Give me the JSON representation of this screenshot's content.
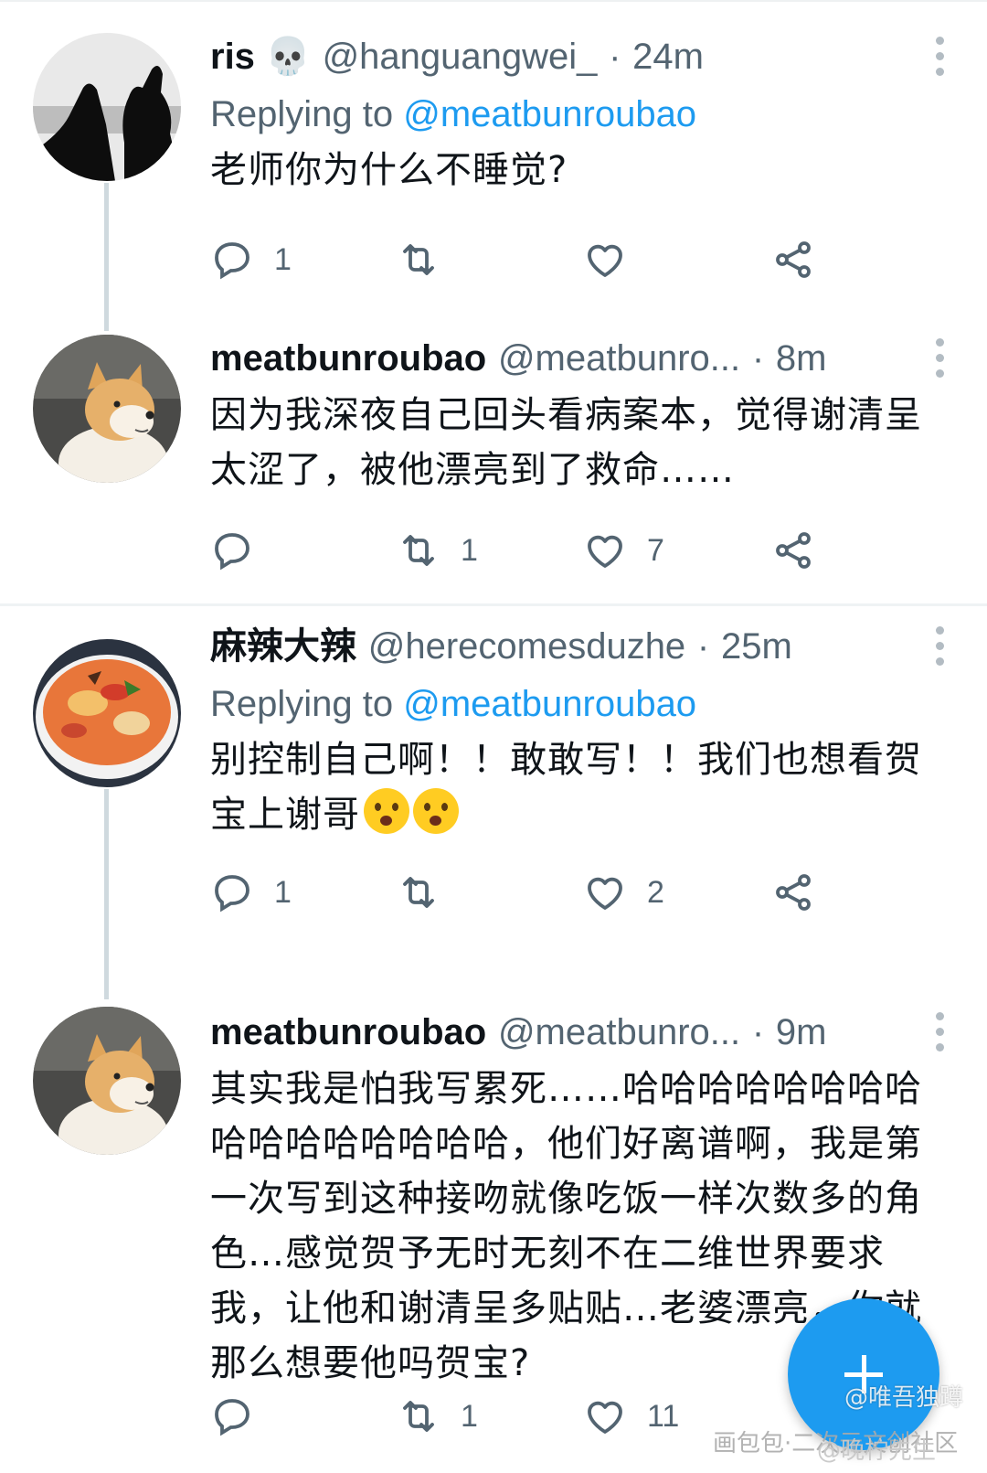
{
  "threads": [
    {
      "parent": {
        "display_name": "ris 💀",
        "handle": "@hanguangwei_",
        "separator": "·",
        "time": "24m",
        "replying_prefix": "Replying to ",
        "replying_to": "@meatbunroubao",
        "text": "老师你为什么不睡觉?",
        "reply_count": "1",
        "retweet_count": "",
        "like_count": ""
      },
      "reply": {
        "display_name": "meatbunroubao",
        "handle": "@meatbunro...",
        "separator": "·",
        "time": "8m",
        "text": "因为我深夜自己回头看病案本，觉得谢清呈太涩了，被他漂亮到了救命……",
        "reply_count": "",
        "retweet_count": "1",
        "like_count": "7"
      }
    },
    {
      "parent": {
        "display_name": "麻辣大辣",
        "handle": "@herecomesduzhe",
        "separator": "·",
        "time": "25m",
        "replying_prefix": "Replying to ",
        "replying_to": "@meatbunroubao",
        "text": "别控制自己啊！！敢敢写！！我们也想看贺宝上谢哥",
        "reply_count": "1",
        "retweet_count": "",
        "like_count": "2"
      },
      "reply": {
        "display_name": "meatbunroubao",
        "handle": "@meatbunro...",
        "separator": "·",
        "time": "9m",
        "text": "其实我是怕我写累死……哈哈哈哈哈哈哈哈哈哈哈哈哈哈哈哈，他们好离谱啊，我是第一次写到这种接吻就像吃饭一样次数多的角色…感觉贺予无时无刻不在二维世界要求我，让他和谢清呈多贴贴…老婆漂亮，你就那么想要他吗贺宝?",
        "reply_count": "",
        "retweet_count": "1",
        "like_count": "11"
      }
    }
  ],
  "watermarks": {
    "line1": "@唯吾独蹲",
    "line2": "画包包·二次元文创社区",
    "line3": "@晚柠先生"
  },
  "colors": {
    "accent": "#1d9bf0",
    "secondary_text": "#536471",
    "primary_text": "#0f1419",
    "thread_line": "#cfd9de"
  },
  "icons": [
    "reply-icon",
    "retweet-icon",
    "like-icon",
    "share-icon",
    "more-icon",
    "compose-icon"
  ]
}
